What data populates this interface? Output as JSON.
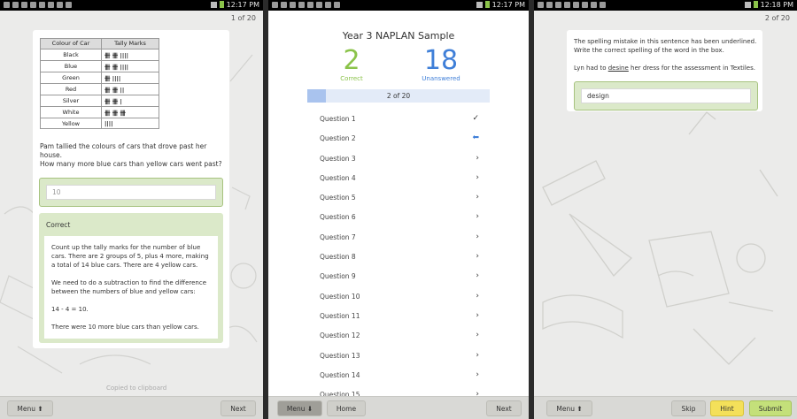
{
  "status": {
    "left_time": "12:17 PM",
    "middle_time": "12:17 PM",
    "right_time": "12:18 PM"
  },
  "screen1": {
    "pager": "1 of 20",
    "table": {
      "headers": [
        "Colour of Car",
        "Tally Marks"
      ],
      "rows": [
        {
          "colour": "Black",
          "marks": "卌 卌 ||||"
        },
        {
          "colour": "Blue",
          "marks": "卌 卌 ||||"
        },
        {
          "colour": "Green",
          "marks": "卌 ||||"
        },
        {
          "colour": "Red",
          "marks": "卌 卌 ||"
        },
        {
          "colour": "Silver",
          "marks": "卌 卌 |"
        },
        {
          "colour": "White",
          "marks": "卌 卌 卌"
        },
        {
          "colour": "Yellow",
          "marks": "||||"
        }
      ]
    },
    "question_line1": "Pam tallied the colours of cars that drove past her house.",
    "question_line2": "How many more blue cars than yellow cars went past?",
    "answer_value": "10",
    "feedback_title": "Correct",
    "feedback_p1": "Count up the tally marks for the number of blue cars. There are 2 groups of 5, plus 4 more, making a total of 14 blue cars. There are 4 yellow cars.",
    "feedback_p2": "We need to do a subtraction to find the difference between the numbers of blue and yellow cars:",
    "feedback_p3": "14 - 4 = 10.",
    "feedback_p4": "There were 10 more blue cars than yellow cars.",
    "watermark": "Copied to clipboard",
    "menu_label": "Menu ⬆",
    "next_label": "Next"
  },
  "screen2": {
    "title": "Year 3 NAPLAN Sample",
    "correct_count": "2",
    "correct_label": "Correct",
    "unanswered_count": "18",
    "unanswered_label": "Unanswered",
    "progress_text": "2 of 20",
    "progress_fraction": 0.1,
    "questions": [
      {
        "label": "Question 1",
        "state": "✓"
      },
      {
        "label": "Question 2",
        "state": "⬅"
      },
      {
        "label": "Question 3",
        "state": "›"
      },
      {
        "label": "Question 4",
        "state": "›"
      },
      {
        "label": "Question 5",
        "state": "›"
      },
      {
        "label": "Question 6",
        "state": "›"
      },
      {
        "label": "Question 7",
        "state": "›"
      },
      {
        "label": "Question 8",
        "state": "›"
      },
      {
        "label": "Question 9",
        "state": "›"
      },
      {
        "label": "Question 10",
        "state": "›"
      },
      {
        "label": "Question 11",
        "state": "›"
      },
      {
        "label": "Question 12",
        "state": "›"
      },
      {
        "label": "Question 13",
        "state": "›"
      },
      {
        "label": "Question 14",
        "state": "›"
      },
      {
        "label": "Question 15",
        "state": "›"
      }
    ],
    "menu_label": "Menu ⬇",
    "home_label": "Home",
    "next_label": "Next"
  },
  "screen3": {
    "pager": "2 of 20",
    "instructions": "The spelling mistake in this sentence has been underlined. Write the correct spelling of the word in the box.",
    "sentence_before": "Lyn had to ",
    "sentence_word": "desine",
    "sentence_after": " her dress for the assessment in Textiles.",
    "answer_value": "design",
    "menu_label": "Menu ⬆",
    "skip_label": "Skip",
    "hint_label": "Hint",
    "submit_label": "Submit"
  }
}
